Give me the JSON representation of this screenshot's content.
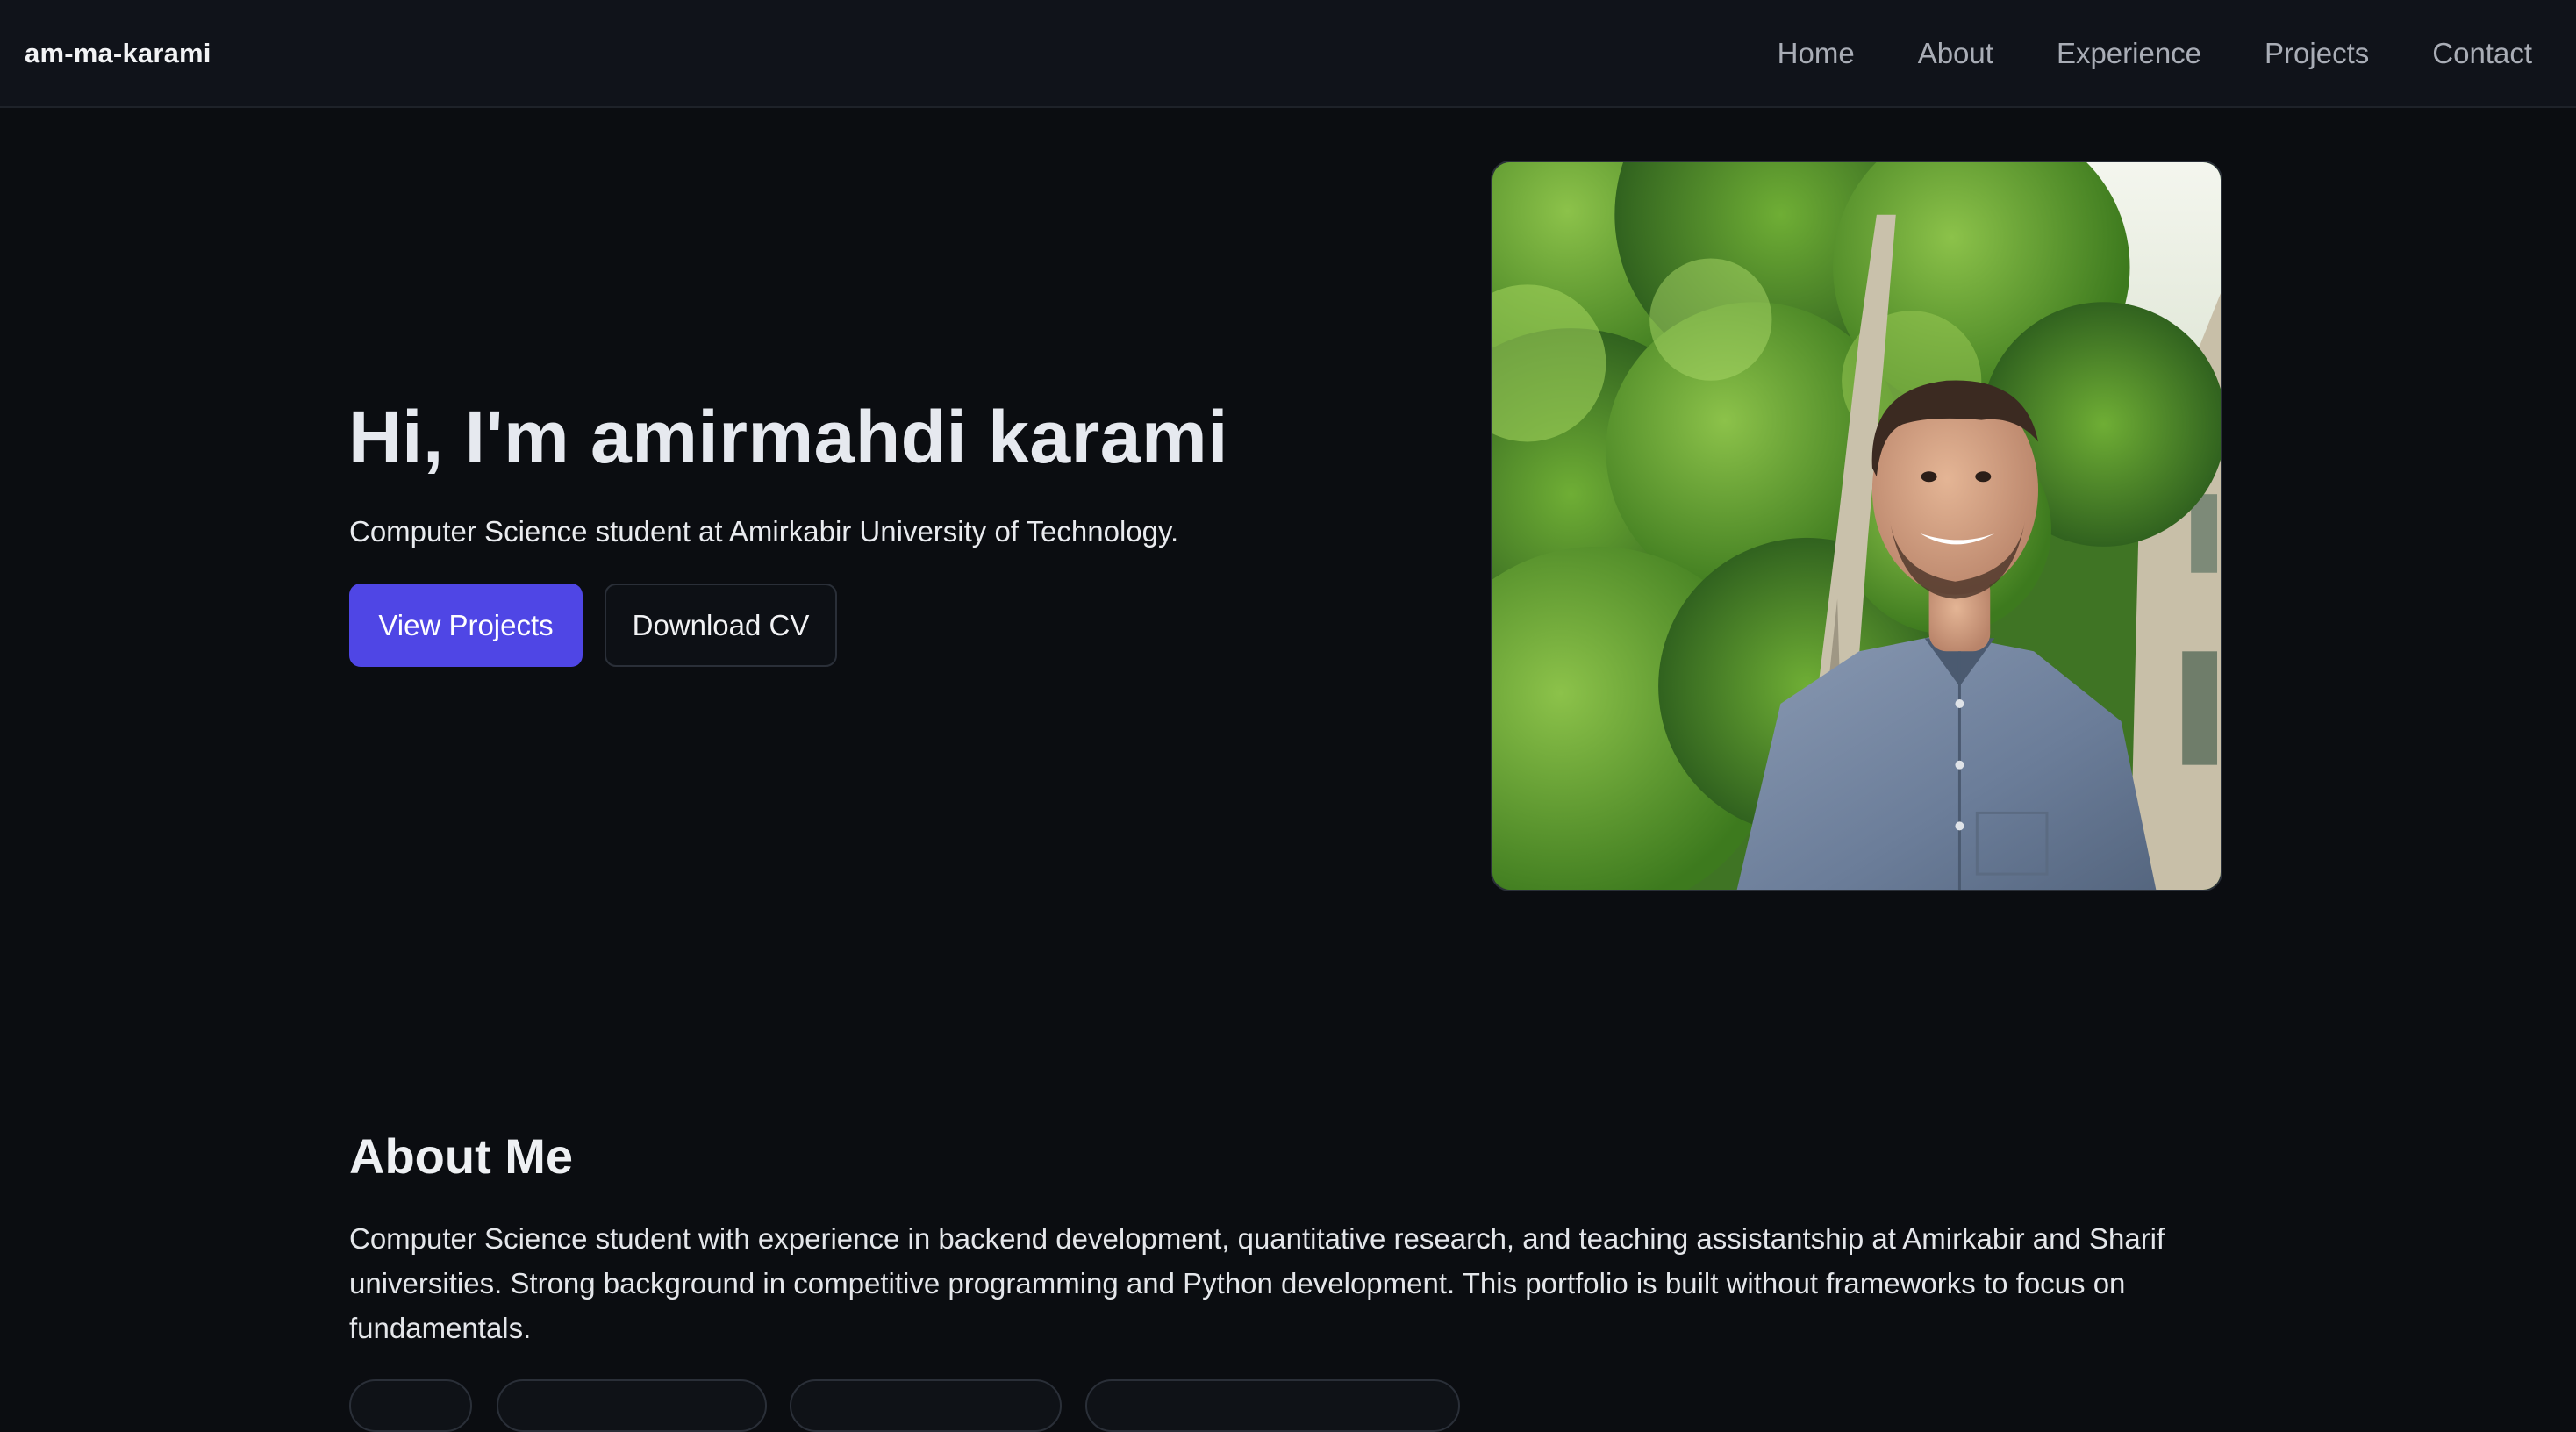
{
  "nav": {
    "brand": "am-ma-karami",
    "links": [
      "Home",
      "About",
      "Experience",
      "Projects",
      "Contact"
    ]
  },
  "hero": {
    "title": "Hi, I'm amirmahdi karami",
    "subtitle": "Computer Science student at Amirkabir University of Technology.",
    "primary_button": "View Projects",
    "secondary_button": "Download CV"
  },
  "about": {
    "title": "About Me",
    "text": "Computer Science student with experience in backend development, quantitative research, and teaching assistantship at Amirkabir and Sharif universities. Strong background in competitive programming and Python development. This portfolio is built without frameworks to focus on fundamentals."
  },
  "colors": {
    "background": "#0b0d11",
    "navbar": "#10131a",
    "accent": "#4f46e5"
  }
}
